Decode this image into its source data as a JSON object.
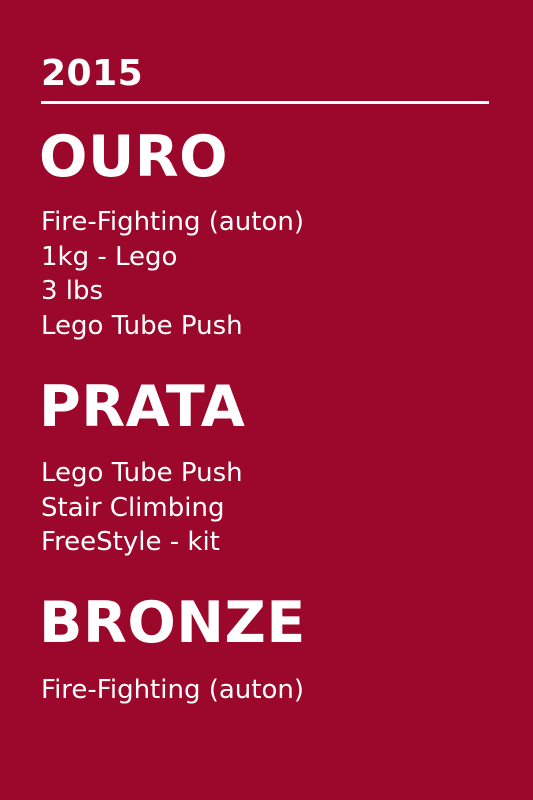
{
  "year": "2015",
  "medals": [
    {
      "title": "OURO",
      "items": [
        "Fire-Fighting (auton)",
        "1kg - Lego",
        "3 lbs",
        "Lego Tube Push"
      ]
    },
    {
      "title": "PRATA",
      "items": [
        "Lego Tube Push",
        "Stair Climbing",
        "FreeStyle - kit"
      ]
    },
    {
      "title": "BRONZE",
      "items": [
        "Fire-Fighting (auton)"
      ]
    }
  ],
  "colors": {
    "background": "#9c082b",
    "text": "#ffffff"
  }
}
